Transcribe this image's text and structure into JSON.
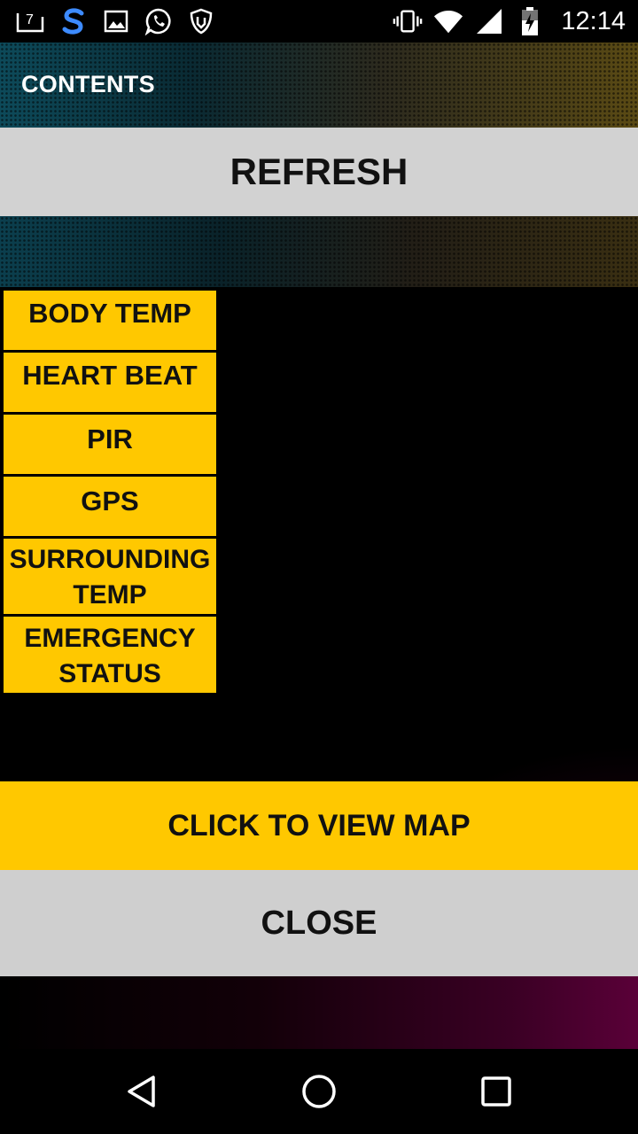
{
  "status_bar": {
    "time": "12:14",
    "notification_badge": "7",
    "icons_left": [
      "notification-count-icon",
      "s-app-icon",
      "image-icon",
      "whatsapp-icon",
      "shield-hand-icon"
    ],
    "icons_right": [
      "vibrate-icon",
      "wifi-icon",
      "signal-icon",
      "battery-charging-icon"
    ]
  },
  "header": {
    "title": "CONTENTS"
  },
  "buttons": {
    "refresh": "REFRESH",
    "view_map": "CLICK TO VIEW MAP",
    "close": "CLOSE"
  },
  "menu": {
    "items": [
      {
        "label": "BODY TEMP"
      },
      {
        "label": "HEART BEAT"
      },
      {
        "label": "PIR"
      },
      {
        "label": "GPS"
      },
      {
        "line1": "SURROUNDING",
        "line2": "TEMP"
      },
      {
        "line1": "EMERGENCY",
        "line2": "STATUS"
      }
    ]
  },
  "colors": {
    "accent_yellow": "#ffc800",
    "button_gray": "#d2d2d2",
    "background": "#000000"
  },
  "nav_bar": {
    "icons": [
      "back-icon",
      "home-icon",
      "recent-apps-icon"
    ]
  }
}
